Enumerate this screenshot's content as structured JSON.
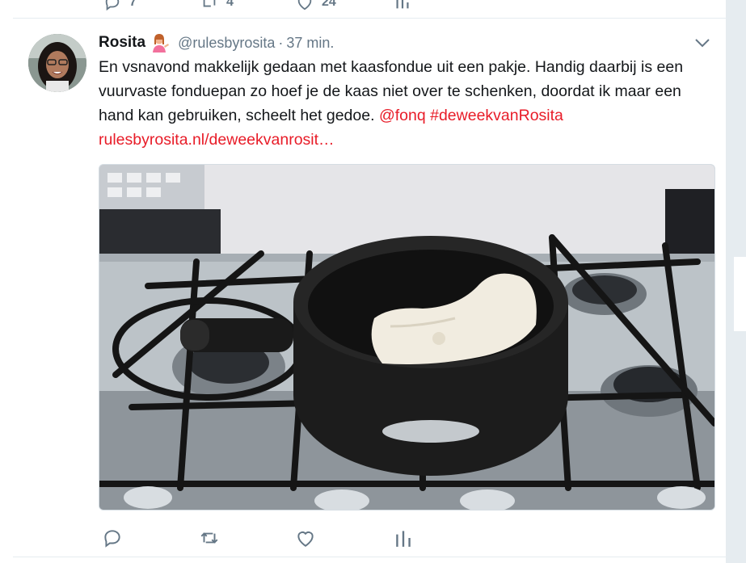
{
  "previous_tweet": {
    "reply_count": "7",
    "retweet_count": "4",
    "like_count": "24"
  },
  "tweet": {
    "author_name": "Rosita",
    "author_emoji": "woman-tipping-hand-emoji",
    "handle": "@rulesbyrosita",
    "separator": "·",
    "timestamp": "37 min.",
    "text_body": "En vsnavond makkelijk gedaan met kaasfondue uit een pakje. Handig daarbij is een vuurvaste fonduepan zo hoef je de kaas niet over te schenken, doordat ik maar een hand kan gebruiken, scheelt het gedoe. ",
    "mention": "@fonq",
    "hashtag": "#deweekvanRosita",
    "url": "rulesbyrosita.nl/deweekvanrosit…",
    "media_description_icon": "photo-fondue-pan-on-stove",
    "actions": {
      "reply_icon": "reply-icon",
      "retweet_icon": "retweet-icon",
      "like_icon": "heart-icon",
      "analytics_icon": "analytics-icon"
    }
  },
  "colors": {
    "link": "#e0245e",
    "muted": "#657786",
    "background": "#e6ecf0"
  }
}
